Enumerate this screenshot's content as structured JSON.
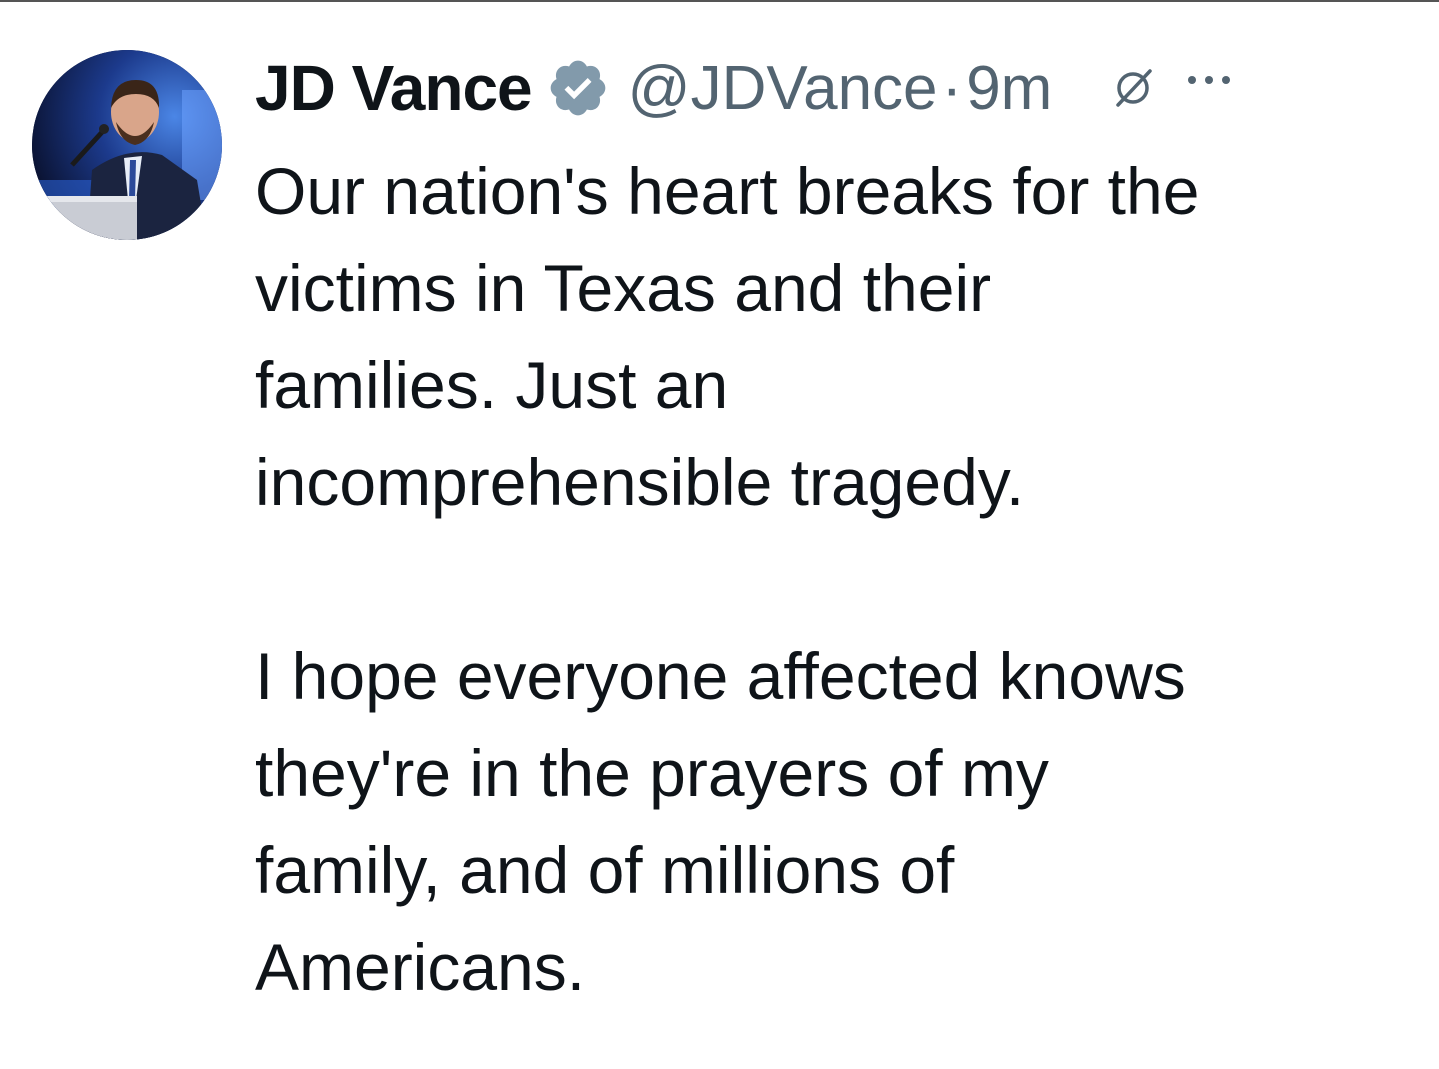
{
  "tweet": {
    "author_name": "JD Vance",
    "handle": "@JDVance",
    "separator": "·",
    "timestamp": "9m",
    "verified_badge_color": "#829aab",
    "paragraph_1": "Our nation's heart breaks for the\nvictims in Texas and their\nfamilies. Just an\nincomprehensible tragedy.",
    "paragraph_2": "I hope everyone affected knows\nthey're in the prayers of my\nfamily, and of millions of\nAmericans."
  },
  "icons": {
    "verified": "verified-badge-icon",
    "edited": "edited-icon",
    "more": "more-options-icon"
  },
  "colors": {
    "text_primary": "#0f1419",
    "text_secondary": "#536471",
    "background": "#ffffff"
  }
}
